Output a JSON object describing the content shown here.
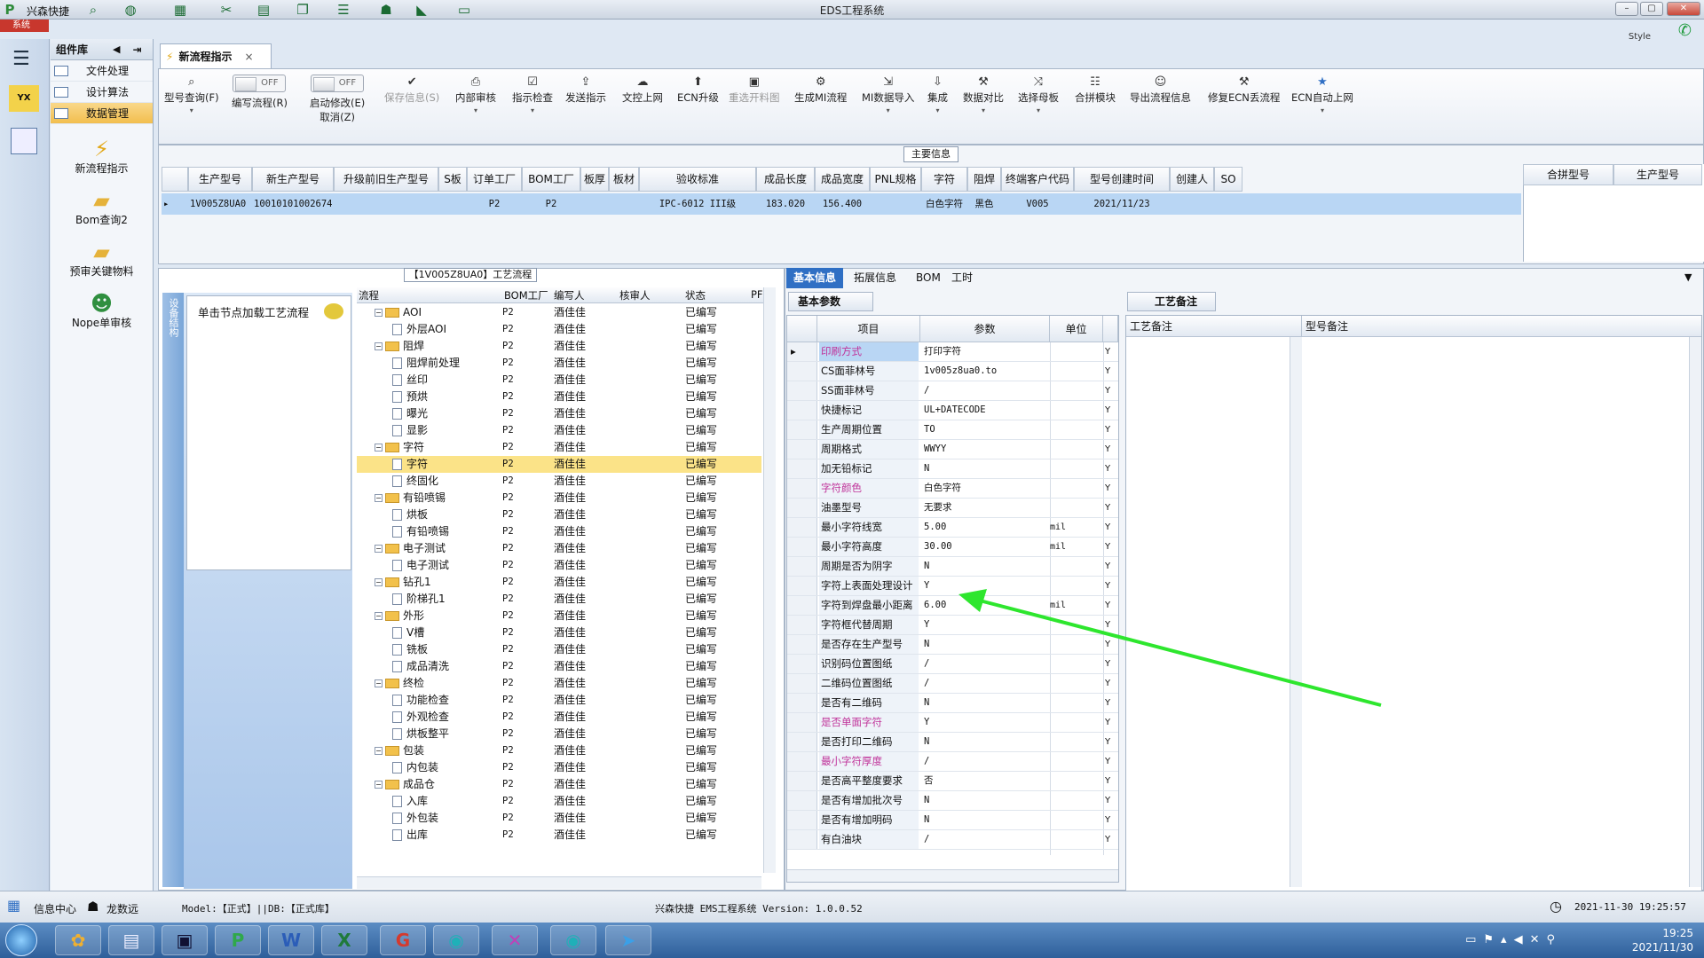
{
  "app": {
    "title": "EDS工程系统",
    "quick_label": "兴森快捷",
    "system_tab": "系统",
    "style_label": "Style"
  },
  "sidebar": {
    "header": "组件库",
    "items": [
      {
        "label": "文件处理",
        "active": false
      },
      {
        "label": "设计算法",
        "active": false
      },
      {
        "label": "数据管理",
        "active": true
      }
    ],
    "big_items": [
      {
        "label": "新流程指示",
        "icon": "lightning-icon"
      },
      {
        "label": "Bom查询2",
        "icon": "folder-icon"
      },
      {
        "label": "预审关键物料",
        "icon": "folder-icon"
      },
      {
        "label": "Nope单审核",
        "icon": "user-icon"
      }
    ]
  },
  "doc_tab": {
    "label": "新流程指示"
  },
  "ribbon": {
    "items": [
      {
        "label": "型号查询(F)",
        "icon": "search-icon",
        "dropdown": true
      },
      {
        "label": "编写流程(R)",
        "toggle": "OFF"
      },
      {
        "label": "启动修改(E)",
        "label2": "取消(Z)",
        "toggle": "OFF"
      },
      {
        "label": "保存信息(S)",
        "icon": "check-icon",
        "disabled": true
      },
      {
        "label": "内部审核",
        "icon": "print-icon",
        "dropdown": true
      },
      {
        "label": "指示检查",
        "icon": "check-icon",
        "dropdown": true
      },
      {
        "label": "发送指示",
        "icon": "upload-icon"
      },
      {
        "label": "文控上网",
        "icon": "cloud-icon"
      },
      {
        "label": "ECN升级",
        "icon": "upgrade-icon"
      },
      {
        "label": "重选开料图",
        "icon": "image-icon",
        "disabled": true
      },
      {
        "label": "生成MI流程",
        "icon": "gear-icon"
      },
      {
        "label": "MI数据导入",
        "icon": "import-icon",
        "dropdown": true
      },
      {
        "label": "集成",
        "icon": "download-icon",
        "dropdown": true
      },
      {
        "label": "数据对比",
        "icon": "tool-icon",
        "dropdown": true
      },
      {
        "label": "选择母板",
        "icon": "shuffle-icon",
        "dropdown": true
      },
      {
        "label": "合拼模块",
        "icon": "list-icon"
      },
      {
        "label": "导出流程信息",
        "icon": "smile-icon"
      },
      {
        "label": "修复ECN丢流程",
        "icon": "wrench-icon"
      },
      {
        "label": "ECN自动上网",
        "icon": "star-icon",
        "dropdown": true
      }
    ]
  },
  "main_info": {
    "label": "主要信息",
    "columns": [
      "生产型号",
      "新生产型号",
      "升级前旧生产型号",
      "S板",
      "订单工厂",
      "BOM工厂",
      "板厚",
      "板材",
      "验收标准",
      "成品长度",
      "成品宽度",
      "PNL规格",
      "字符",
      "阻焊",
      "终端客户代码",
      "型号创建时间",
      "创建人",
      "SO"
    ],
    "row": [
      "1V005Z8UA0",
      "10010101002674",
      "",
      "",
      "P2",
      "P2",
      "",
      "",
      "IPC-6012 III级",
      "183.020",
      "156.400",
      "",
      "白色字符",
      "黑色",
      "V005",
      "2021/11/23",
      "",
      ""
    ],
    "side_columns": [
      "合拼型号",
      "生产型号"
    ]
  },
  "flow_panel": {
    "title": "【1V005Z8UA0】工艺流程",
    "vertical_tab": "设备结构",
    "hint": "单击节点加载工艺流程",
    "columns": [
      "流程",
      "BOM工厂",
      "编写人",
      "核审人",
      "状态",
      "PF"
    ],
    "rows": [
      {
        "name": "AOI",
        "level": 0,
        "type": "folder",
        "factory": "P2",
        "writer": "酒佳佳",
        "status": "已编写"
      },
      {
        "name": "外层AOI",
        "level": 1,
        "type": "doc",
        "factory": "P2",
        "writer": "酒佳佳",
        "status": "已编写"
      },
      {
        "name": "阻焊",
        "level": 0,
        "type": "folder",
        "factory": "P2",
        "writer": "酒佳佳",
        "status": "已编写"
      },
      {
        "name": "阻焊前处理",
        "level": 1,
        "type": "doc",
        "factory": "P2",
        "writer": "酒佳佳",
        "status": "已编写"
      },
      {
        "name": "丝印",
        "level": 1,
        "type": "doc",
        "factory": "P2",
        "writer": "酒佳佳",
        "status": "已编写"
      },
      {
        "name": "预烘",
        "level": 1,
        "type": "doc",
        "factory": "P2",
        "writer": "酒佳佳",
        "status": "已编写"
      },
      {
        "name": "曝光",
        "level": 1,
        "type": "doc",
        "factory": "P2",
        "writer": "酒佳佳",
        "status": "已编写"
      },
      {
        "name": "显影",
        "level": 1,
        "type": "doc",
        "factory": "P2",
        "writer": "酒佳佳",
        "status": "已编写"
      },
      {
        "name": "字符",
        "level": 0,
        "type": "folder",
        "factory": "P2",
        "writer": "酒佳佳",
        "status": "已编写"
      },
      {
        "name": "字符",
        "level": 1,
        "type": "doc",
        "factory": "P2",
        "writer": "酒佳佳",
        "status": "已编写",
        "selected": true
      },
      {
        "name": "终固化",
        "level": 1,
        "type": "doc",
        "factory": "P2",
        "writer": "酒佳佳",
        "status": "已编写"
      },
      {
        "name": "有铅喷锡",
        "level": 0,
        "type": "folder",
        "factory": "P2",
        "writer": "酒佳佳",
        "status": "已编写"
      },
      {
        "name": "烘板",
        "level": 1,
        "type": "doc",
        "factory": "P2",
        "writer": "酒佳佳",
        "status": "已编写"
      },
      {
        "name": "有铅喷锡",
        "level": 1,
        "type": "doc",
        "factory": "P2",
        "writer": "酒佳佳",
        "status": "已编写"
      },
      {
        "name": "电子测试",
        "level": 0,
        "type": "folder",
        "factory": "P2",
        "writer": "酒佳佳",
        "status": "已编写"
      },
      {
        "name": "电子测试",
        "level": 1,
        "type": "doc",
        "factory": "P2",
        "writer": "酒佳佳",
        "status": "已编写"
      },
      {
        "name": "钻孔1",
        "level": 0,
        "type": "folder",
        "factory": "P2",
        "writer": "酒佳佳",
        "status": "已编写"
      },
      {
        "name": "阶梯孔1",
        "level": 1,
        "type": "doc",
        "factory": "P2",
        "writer": "酒佳佳",
        "status": "已编写"
      },
      {
        "name": "外形",
        "level": 0,
        "type": "folder",
        "factory": "P2",
        "writer": "酒佳佳",
        "status": "已编写"
      },
      {
        "name": "V槽",
        "level": 1,
        "type": "doc",
        "factory": "P2",
        "writer": "酒佳佳",
        "status": "已编写"
      },
      {
        "name": "铣板",
        "level": 1,
        "type": "doc",
        "factory": "P2",
        "writer": "酒佳佳",
        "status": "已编写"
      },
      {
        "name": "成品清洗",
        "level": 1,
        "type": "doc",
        "factory": "P2",
        "writer": "酒佳佳",
        "status": "已编写"
      },
      {
        "name": "终检",
        "level": 0,
        "type": "folder",
        "factory": "P2",
        "writer": "酒佳佳",
        "status": "已编写"
      },
      {
        "name": "功能检查",
        "level": 1,
        "type": "doc",
        "factory": "P2",
        "writer": "酒佳佳",
        "status": "已编写"
      },
      {
        "name": "外观检查",
        "level": 1,
        "type": "doc",
        "factory": "P2",
        "writer": "酒佳佳",
        "status": "已编写"
      },
      {
        "name": "烘板整平",
        "level": 1,
        "type": "doc",
        "factory": "P2",
        "writer": "酒佳佳",
        "status": "已编写"
      },
      {
        "name": "包装",
        "level": 0,
        "type": "folder",
        "factory": "P2",
        "writer": "酒佳佳",
        "status": "已编写"
      },
      {
        "name": "内包装",
        "level": 1,
        "type": "doc",
        "factory": "P2",
        "writer": "酒佳佳",
        "status": "已编写"
      },
      {
        "name": "成品仓",
        "level": 0,
        "type": "folder",
        "factory": "P2",
        "writer": "酒佳佳",
        "status": "已编写"
      },
      {
        "name": "入库",
        "level": 1,
        "type": "doc",
        "factory": "P2",
        "writer": "酒佳佳",
        "status": "已编写"
      },
      {
        "name": "外包装",
        "level": 1,
        "type": "doc",
        "factory": "P2",
        "writer": "酒佳佳",
        "status": "已编写"
      },
      {
        "name": "出库",
        "level": 1,
        "type": "doc",
        "factory": "P2",
        "writer": "酒佳佳",
        "status": "已编写"
      }
    ]
  },
  "right_panel": {
    "tabs": [
      "基本信息",
      "拓展信息",
      "BOM",
      "工时"
    ],
    "subtab": "基本参数",
    "remark_tab": "工艺备注",
    "columns": [
      "项目",
      "参数",
      "单位"
    ],
    "params": [
      {
        "item": "印刷方式",
        "value": "打印字符",
        "unit": "",
        "flag": "Y",
        "pink": true,
        "current": true
      },
      {
        "item": "CS面菲林号",
        "value": "1v005z8ua0.to",
        "unit": "",
        "flag": "Y"
      },
      {
        "item": "SS面菲林号",
        "value": "/",
        "unit": "",
        "flag": "Y"
      },
      {
        "item": "快捷标记",
        "value": "UL+DATECODE",
        "unit": "",
        "flag": "Y"
      },
      {
        "item": "生产周期位置",
        "value": "TO",
        "unit": "",
        "flag": "Y"
      },
      {
        "item": "周期格式",
        "value": "WWYY",
        "unit": "",
        "flag": "Y"
      },
      {
        "item": "加无铅标记",
        "value": "N",
        "unit": "",
        "flag": "Y"
      },
      {
        "item": "字符颜色",
        "value": "白色字符",
        "unit": "",
        "flag": "Y",
        "pink": true
      },
      {
        "item": "油墨型号",
        "value": "无要求",
        "unit": "",
        "flag": "Y"
      },
      {
        "item": "最小字符线宽",
        "value": "5.00",
        "unit": "mil",
        "flag": "Y"
      },
      {
        "item": "最小字符高度",
        "value": "30.00",
        "unit": "mil",
        "flag": "Y"
      },
      {
        "item": "周期是否为阴字",
        "value": "N",
        "unit": "",
        "flag": "Y"
      },
      {
        "item": "字符上表面处理设计",
        "value": "Y",
        "unit": "",
        "flag": "Y"
      },
      {
        "item": "字符到焊盘最小距离",
        "value": "6.00",
        "unit": "mil",
        "flag": "Y"
      },
      {
        "item": "字符框代替周期",
        "value": "Y",
        "unit": "",
        "flag": "Y"
      },
      {
        "item": "是否存在生产型号",
        "value": "N",
        "unit": "",
        "flag": "Y"
      },
      {
        "item": "识别码位置图纸",
        "value": "/",
        "unit": "",
        "flag": "Y"
      },
      {
        "item": "二维码位置图纸",
        "value": "/",
        "unit": "",
        "flag": "Y"
      },
      {
        "item": "是否有二维码",
        "value": "N",
        "unit": "",
        "flag": "Y"
      },
      {
        "item": "是否单面字符",
        "value": "Y",
        "unit": "",
        "flag": "Y",
        "pink": true
      },
      {
        "item": "是否打印二维码",
        "value": "N",
        "unit": "",
        "flag": "Y"
      },
      {
        "item": "最小字符厚度",
        "value": "/",
        "unit": "",
        "flag": "Y",
        "pink": true
      },
      {
        "item": "是否高平整度要求",
        "value": "否",
        "unit": "",
        "flag": "Y"
      },
      {
        "item": "是否有增加批次号",
        "value": "N",
        "unit": "",
        "flag": "Y"
      },
      {
        "item": "是否有增加明码",
        "value": "N",
        "unit": "",
        "flag": "Y"
      },
      {
        "item": "有白油块",
        "value": "/",
        "unit": "",
        "flag": "Y"
      }
    ],
    "remark_columns": [
      "工艺备注",
      "型号备注"
    ]
  },
  "status_bar": {
    "info_center": "信息中心",
    "user": "龙数远",
    "model": "Model:【正式】||DB:【正式库】",
    "version": "兴森快捷 EMS工程系统 Version: 1.0.0.52",
    "datetime": "2021-11-30 19:25:57"
  },
  "taskbar": {
    "time": "19:25",
    "date": "2021/11/30"
  },
  "colors": {
    "arrow": "#2ee62e",
    "active_tab": "#2f6fc4",
    "selected_row": "#fbe388",
    "pink_label": "#c0339a"
  }
}
